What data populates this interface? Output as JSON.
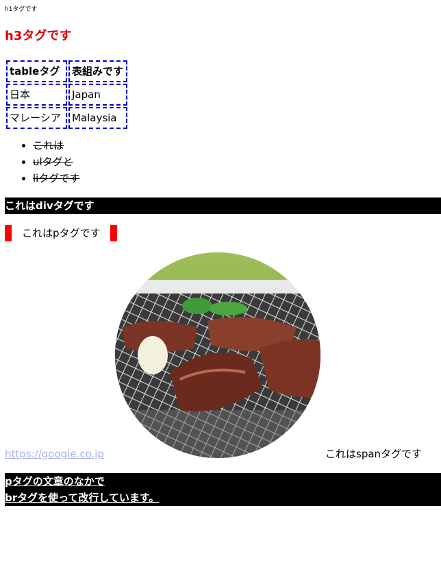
{
  "h1": "h1タグです",
  "h3": "h3タグです",
  "table": {
    "headers": [
      "tableタグ",
      "表組みです"
    ],
    "rows": [
      [
        "日本",
        "Japan"
      ],
      [
        "マレーシア",
        "Malaysia"
      ]
    ]
  },
  "list": [
    "これは",
    "ulタグと",
    "liタグです"
  ],
  "div_text": "これはdivタグです",
  "p_text": "これはpタグです",
  "image": {
    "subject": "grilled meat on a barbecue grill"
  },
  "link_text": "https://google.co.jp",
  "span_text": "これはspanタグです",
  "br_lines": [
    "pタグの文章のなかで",
    "brタグを使って改行しています。"
  ],
  "colors": {
    "h3": "#e00000",
    "table_border": "#0000cc",
    "p_border": "#ff0000",
    "link": "#aab4ee",
    "bar_bg": "#000000"
  }
}
